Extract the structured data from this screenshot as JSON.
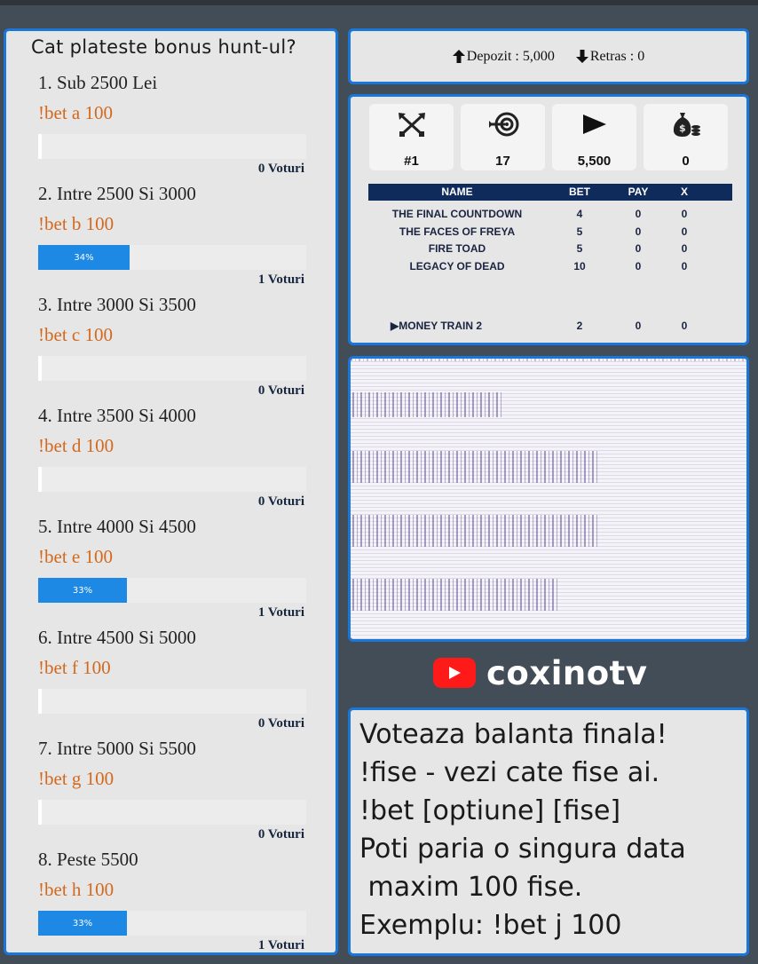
{
  "poll": {
    "title": "Cat plateste bonus hunt-ul?",
    "options": [
      {
        "label": "1. Sub 2500 Lei",
        "command": "!bet a 100",
        "percent": 0,
        "percent_label": "",
        "votes": "0 Voturi"
      },
      {
        "label": "2. Intre 2500 Si 3000",
        "command": "!bet b 100",
        "percent": 34,
        "percent_label": "34%",
        "votes": "1 Voturi"
      },
      {
        "label": "3. Intre 3000 Si 3500",
        "command": "!bet c 100",
        "percent": 0,
        "percent_label": "",
        "votes": "0 Voturi"
      },
      {
        "label": "4. Intre 3500 Si 4000",
        "command": "!bet d 100",
        "percent": 0,
        "percent_label": "",
        "votes": "0 Voturi"
      },
      {
        "label": "5. Intre 4000 Si 4500",
        "command": "!bet e 100",
        "percent": 33,
        "percent_label": "33%",
        "votes": "1 Voturi"
      },
      {
        "label": "6. Intre 4500 Si 5000",
        "command": "!bet f 100",
        "percent": 0,
        "percent_label": "",
        "votes": "0 Voturi"
      },
      {
        "label": "7. Intre 5000 Si 5500",
        "command": "!bet g 100",
        "percent": 0,
        "percent_label": "",
        "votes": "0 Voturi"
      },
      {
        "label": "8. Peste 5500",
        "command": "!bet h 100",
        "percent": 33,
        "percent_label": "33%",
        "votes": "1 Voturi"
      }
    ]
  },
  "deposit": {
    "deposit_text": "Depozit : 5,000",
    "withdraw_text": "Retras : 0"
  },
  "stats": {
    "cards": [
      {
        "icon": "crossed-arrows-icon",
        "value": "#1"
      },
      {
        "icon": "target-icon",
        "value": "17"
      },
      {
        "icon": "play-icon",
        "value": "5,500"
      },
      {
        "icon": "money-bag-icon",
        "value": "0"
      }
    ],
    "table": {
      "headers": {
        "name": "NAME",
        "bet": "BET",
        "pay": "PAY",
        "x": "X"
      },
      "rows": [
        {
          "name": "THE FINAL COUNTDOWN",
          "bet": "4",
          "pay": "0",
          "x": "0"
        },
        {
          "name": "THE FACES OF FREYA",
          "bet": "5",
          "pay": "0",
          "x": "0"
        },
        {
          "name": "FIRE TOAD",
          "bet": "5",
          "pay": "0",
          "x": "0"
        },
        {
          "name": "LEGACY OF DEAD",
          "bet": "10",
          "pay": "0",
          "x": "0"
        }
      ],
      "current": {
        "name": "MONEY TRAIN 2",
        "bet": "2",
        "pay": "0",
        "x": "0"
      }
    }
  },
  "brand": {
    "name": "coxinotv",
    "icon": "youtube-icon",
    "color": "#ff1a1a"
  },
  "instructions": {
    "lines": [
      "Voteaza balanta finala!",
      "!fise - vezi cate fise ai.",
      "!bet [optiune] [fise]",
      "Poti paria o singura data",
      " maxim 100 fise.",
      "Exemplu: !bet j 100"
    ]
  },
  "colors": {
    "accent": "#1877d9",
    "bar": "#1e88e5",
    "command": "#d2691e",
    "table_header": "#0f2b5b",
    "background": "#434d57"
  }
}
